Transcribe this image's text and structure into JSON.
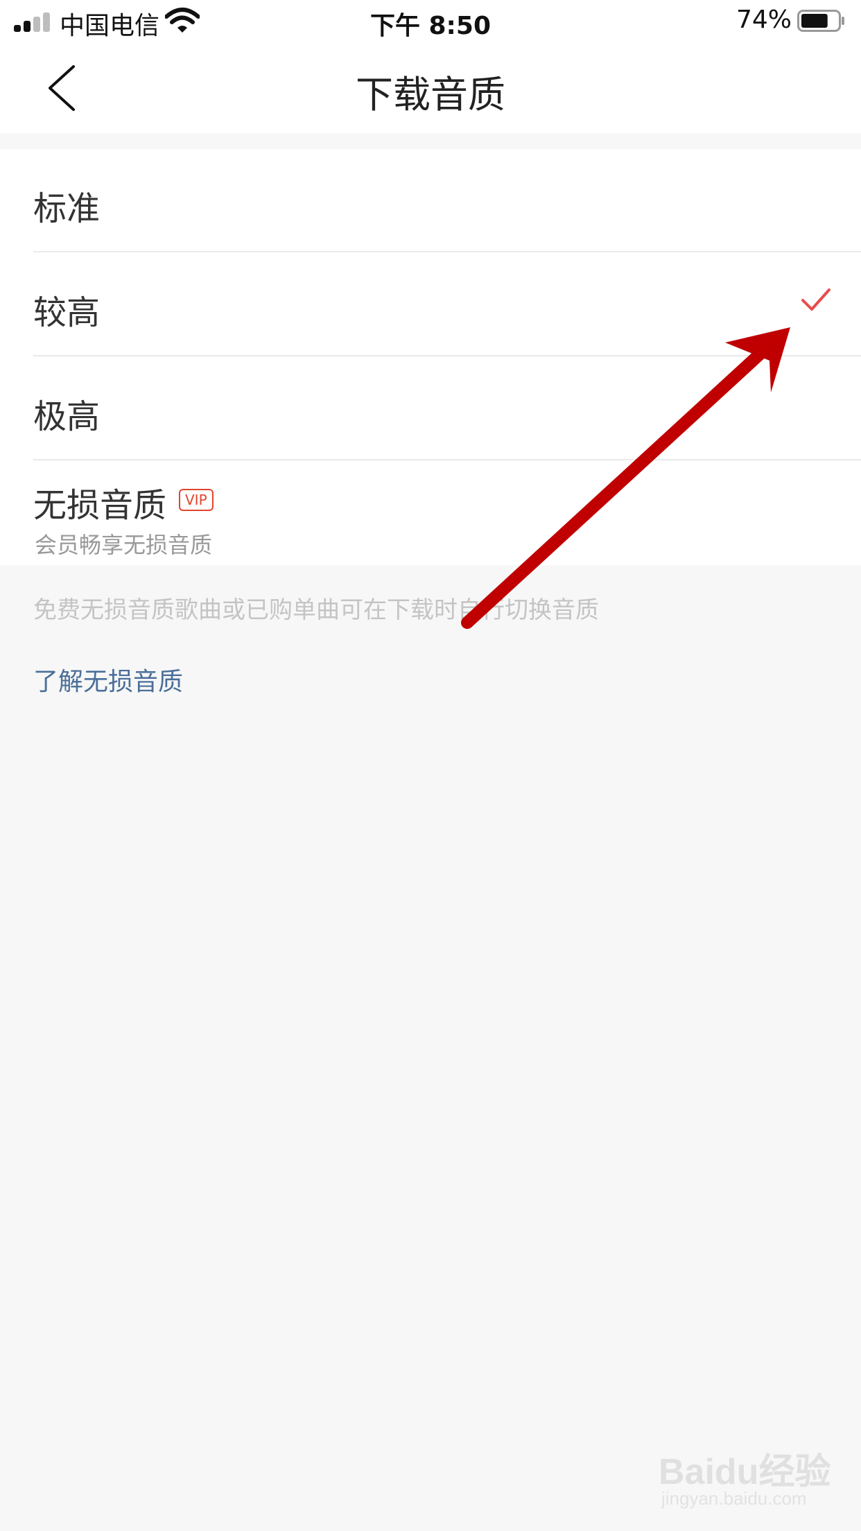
{
  "status_bar": {
    "carrier": "中国电信",
    "time": "下午 8:50",
    "battery_percent": "74%",
    "battery_level": 0.74
  },
  "nav": {
    "title": "下载音质"
  },
  "options": [
    {
      "label": "标准",
      "selected": false
    },
    {
      "label": "较高",
      "selected": true
    },
    {
      "label": "极高",
      "selected": false
    },
    {
      "label": "无损音质",
      "badge": "VIP",
      "subtitle": "会员畅享无损音质",
      "selected": false
    }
  ],
  "note": "免费无损音质歌曲或已购单曲可在下载时自行切换音质",
  "learn_link": "了解无损音质",
  "watermark": {
    "top": "Baidu经验",
    "bottom": "jingyan.baidu.com"
  },
  "colors": {
    "check": "#e94b4b",
    "annotation_arrow": "#c00000",
    "vip": "#e0452c",
    "link": "#4a6f9a"
  }
}
